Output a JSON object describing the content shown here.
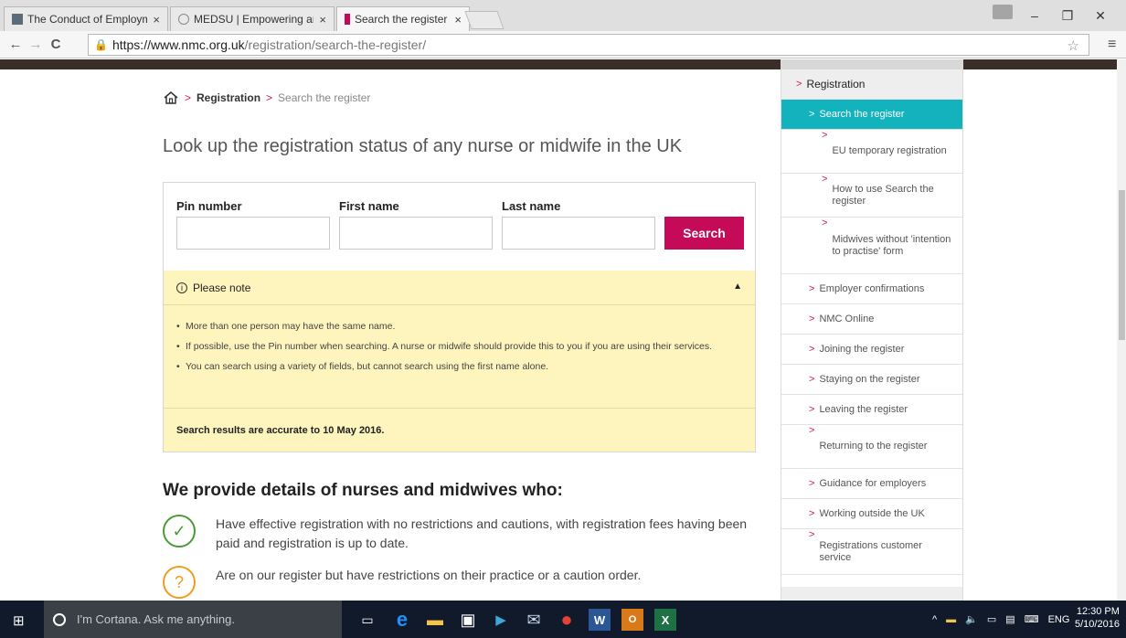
{
  "browser": {
    "tabs": [
      {
        "title": "The Conduct of Employm",
        "active": false
      },
      {
        "title": "MEDSU | Empowering anc",
        "active": false
      },
      {
        "title": "Search the register",
        "active": true
      }
    ],
    "url_host": "https://www.nmc.org.uk",
    "url_path": "/registration/search-the-register/"
  },
  "breadcrumb": {
    "registration": "Registration",
    "current": "Search the register"
  },
  "page": {
    "lookup_title": "Look up the registration status of any nurse or midwife in the UK",
    "search": {
      "pin_label": "Pin number",
      "first_label": "First name",
      "last_label": "Last name",
      "pin_value": "",
      "first_value": "",
      "last_value": "",
      "button": "Search"
    },
    "note": {
      "heading": "Please note",
      "items": [
        "More than one person may have the same name.",
        "If possible, use the Pin number when searching. A nurse or midwife should provide this to you if you are using their services.",
        "You can search using a variety of fields, but cannot search using the first name alone."
      ],
      "footer": "Search results are accurate to 10 May 2016."
    },
    "provide_title": "We provide details of nurses and midwives who:",
    "provide_items": [
      {
        "text": "Have effective registration with no restrictions and cautions, with registration fees having been paid and registration is up to date.",
        "icon": "check-icon",
        "color": "#4a9a3a"
      },
      {
        "text": "Are on our register but have restrictions on their practice or a caution order.",
        "icon": "question-icon",
        "color": "#f29c1f"
      }
    ]
  },
  "sidebar": {
    "section": "Registration",
    "items": [
      {
        "label": "Search the register",
        "level": 1,
        "active": true
      },
      {
        "label": "EU temporary registration",
        "level": 2
      },
      {
        "label": "How to use Search the register",
        "level": 2
      },
      {
        "label": "Midwives without 'intention to practise' form",
        "level": 2
      },
      {
        "label": "Employer confirmations",
        "level": 1
      },
      {
        "label": "NMC Online",
        "level": 1
      },
      {
        "label": "Joining the register",
        "level": 1
      },
      {
        "label": "Staying on the register",
        "level": 1
      },
      {
        "label": "Leaving the register",
        "level": 1
      },
      {
        "label": "Returning to the register",
        "level": 1
      },
      {
        "label": "Guidance for employers",
        "level": 1
      },
      {
        "label": "Working outside the UK",
        "level": 1
      },
      {
        "label": "Registrations customer service",
        "level": 1
      }
    ]
  },
  "taskbar": {
    "cortana_placeholder": "I'm Cortana. Ask me anything.",
    "lang": "ENG",
    "time": "12:30 PM",
    "date": "5/10/2016"
  },
  "colors": {
    "brand_pink": "#c50b57",
    "active_teal": "#12b3bd",
    "note_bg": "#fdf5bd"
  }
}
